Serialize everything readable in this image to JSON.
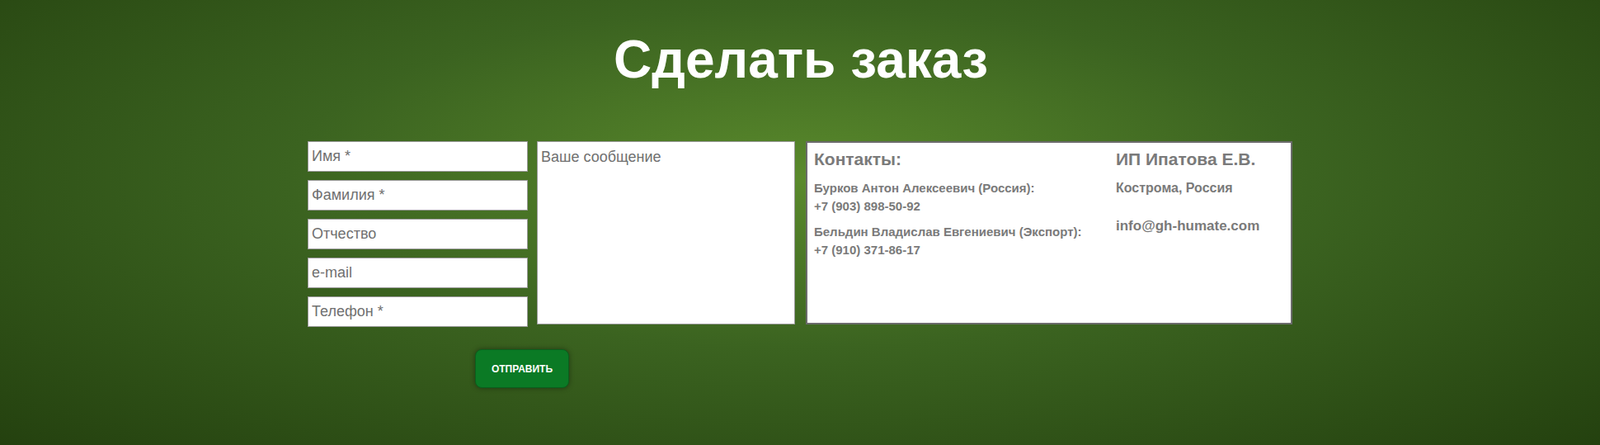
{
  "title": "Сделать заказ",
  "form": {
    "fields": [
      {
        "placeholder": "Имя *"
      },
      {
        "placeholder": "Фамилия *"
      },
      {
        "placeholder": "Отчество"
      },
      {
        "placeholder": "e-mail"
      },
      {
        "placeholder": "Телефон *"
      }
    ],
    "message": {
      "placeholder": "Ваше сообщение"
    },
    "submit": "ОТПРАВИТЬ"
  },
  "contacts": {
    "heading": "Контакты:",
    "people": [
      {
        "name": "Бурков Антон Алексеевич (Россия):",
        "phone": "+7 (903) 898-50-92"
      },
      {
        "name": "Бельдин Владислав Евгениевич (Экспорт):",
        "phone": "+7 (910) 371-86-17"
      }
    ],
    "company": "ИП Ипатова Е.В.",
    "location": "Кострома, Россия",
    "email": "info@gh-humate.com"
  }
}
